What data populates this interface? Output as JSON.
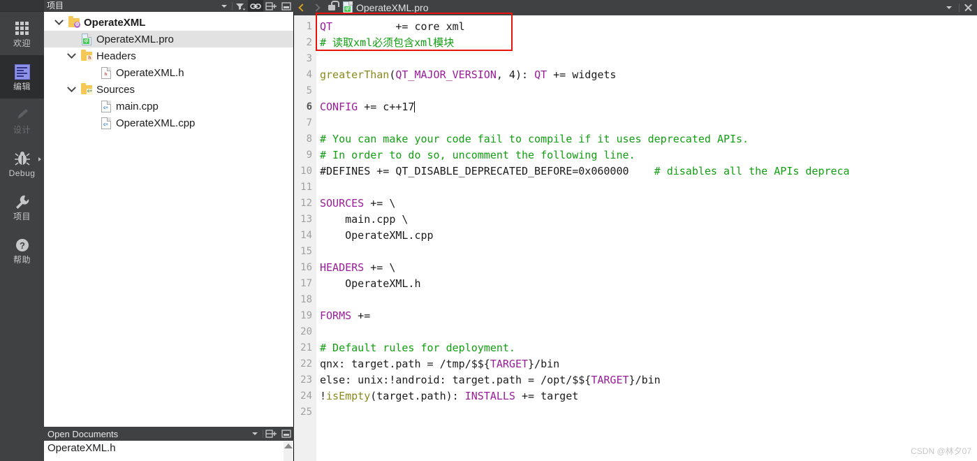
{
  "modebar": {
    "items": [
      {
        "label": "欢迎",
        "icon": "grid-icon",
        "state": "normal"
      },
      {
        "label": "编辑",
        "icon": "edit-icon",
        "state": "selected"
      },
      {
        "label": "设计",
        "icon": "pencil-icon",
        "state": "disabled"
      },
      {
        "label": "Debug",
        "icon": "bug-icon",
        "state": "normal"
      },
      {
        "label": "项目",
        "icon": "wrench-icon",
        "state": "normal"
      },
      {
        "label": "帮助",
        "icon": "question-icon",
        "state": "normal"
      }
    ]
  },
  "project_panel": {
    "title": "项目",
    "header_buttons": [
      {
        "name": "filter-icon",
        "label": ""
      },
      {
        "name": "link-icon",
        "label": ""
      },
      {
        "name": "split-add-icon",
        "label": ""
      },
      {
        "name": "minimize-icon",
        "label": ""
      }
    ],
    "tree": [
      {
        "label": "OperateXML",
        "depth": 0,
        "icon": "folder-project-icon",
        "expanded": true,
        "bold": true,
        "selected": false
      },
      {
        "label": "OperateXML.pro",
        "depth": 1,
        "icon": "file-pro-icon",
        "expanded": null,
        "bold": false,
        "selected": true
      },
      {
        "label": "Headers",
        "depth": 1,
        "icon": "folder-headers-icon",
        "expanded": true,
        "bold": false,
        "selected": false
      },
      {
        "label": "OperateXML.h",
        "depth": 2,
        "icon": "file-h-icon",
        "expanded": null,
        "bold": false,
        "selected": false
      },
      {
        "label": "Sources",
        "depth": 1,
        "icon": "folder-sources-icon",
        "expanded": true,
        "bold": false,
        "selected": false
      },
      {
        "label": "main.cpp",
        "depth": 2,
        "icon": "file-cpp-icon",
        "expanded": null,
        "bold": false,
        "selected": false
      },
      {
        "label": "OperateXML.cpp",
        "depth": 2,
        "icon": "file-cpp-icon",
        "expanded": null,
        "bold": false,
        "selected": false
      }
    ]
  },
  "open_documents": {
    "title": "Open Documents",
    "items": [
      {
        "label": "OperateXML.h"
      }
    ]
  },
  "editor": {
    "tab": {
      "filename": "OperateXML.pro",
      "back_icon": "back-arrow-icon",
      "forward_icon": "forward-arrow-icon",
      "lock_icon": "unlocked-padlock-icon",
      "file_icon": "file-pro-icon",
      "dropdown_icon": "chevron-down-icon",
      "close_icon": "close-icon"
    },
    "cursor_line": 6,
    "lines": [
      {
        "n": 1,
        "tokens": [
          {
            "t": "QT",
            "c": "t-var"
          },
          {
            "t": "          += core xml",
            "c": "t-plain"
          }
        ]
      },
      {
        "n": 2,
        "tokens": [
          {
            "t": "# 读取xml必须包含xml模块",
            "c": "t-cmt"
          }
        ]
      },
      {
        "n": 3,
        "tokens": []
      },
      {
        "n": 4,
        "tokens": [
          {
            "t": "greaterThan",
            "c": "t-fn"
          },
          {
            "t": "(",
            "c": "t-plain"
          },
          {
            "t": "QT_MAJOR_VERSION",
            "c": "t-var"
          },
          {
            "t": ", 4): ",
            "c": "t-plain"
          },
          {
            "t": "QT",
            "c": "t-var"
          },
          {
            "t": " += widgets",
            "c": "t-plain"
          }
        ]
      },
      {
        "n": 5,
        "tokens": []
      },
      {
        "n": 6,
        "tokens": [
          {
            "t": "CONFIG",
            "c": "t-var"
          },
          {
            "t": " += c++17",
            "c": "t-plain"
          }
        ],
        "caret": true
      },
      {
        "n": 7,
        "tokens": []
      },
      {
        "n": 8,
        "tokens": [
          {
            "t": "# You can make your code fail to compile if it uses deprecated APIs.",
            "c": "t-cmt"
          }
        ]
      },
      {
        "n": 9,
        "tokens": [
          {
            "t": "# In order to do so, uncomment the following line.",
            "c": "t-cmt"
          }
        ]
      },
      {
        "n": 10,
        "tokens": [
          {
            "t": "#DEFINES += QT_DISABLE_DEPRECATED_BEFORE=0x060000",
            "c": "t-plain"
          },
          {
            "t": "    # disables all the APIs depreca",
            "c": "t-cmt"
          }
        ]
      },
      {
        "n": 11,
        "tokens": []
      },
      {
        "n": 12,
        "tokens": [
          {
            "t": "SOURCES",
            "c": "t-var"
          },
          {
            "t": " += \\",
            "c": "t-plain"
          }
        ]
      },
      {
        "n": 13,
        "tokens": [
          {
            "t": "    main.cpp \\",
            "c": "t-plain"
          }
        ]
      },
      {
        "n": 14,
        "tokens": [
          {
            "t": "    OperateXML.cpp",
            "c": "t-plain"
          }
        ]
      },
      {
        "n": 15,
        "tokens": []
      },
      {
        "n": 16,
        "tokens": [
          {
            "t": "HEADERS",
            "c": "t-var"
          },
          {
            "t": " += \\",
            "c": "t-plain"
          }
        ]
      },
      {
        "n": 17,
        "tokens": [
          {
            "t": "    OperateXML.h",
            "c": "t-plain"
          }
        ]
      },
      {
        "n": 18,
        "tokens": []
      },
      {
        "n": 19,
        "tokens": [
          {
            "t": "FORMS",
            "c": "t-var"
          },
          {
            "t": " +=",
            "c": "t-plain"
          }
        ]
      },
      {
        "n": 20,
        "tokens": []
      },
      {
        "n": 21,
        "tokens": [
          {
            "t": "# Default rules for deployment.",
            "c": "t-cmt"
          }
        ]
      },
      {
        "n": 22,
        "tokens": [
          {
            "t": "qnx: target.path = /tmp/$${",
            "c": "t-plain"
          },
          {
            "t": "TARGET",
            "c": "t-var"
          },
          {
            "t": "}/bin",
            "c": "t-plain"
          }
        ]
      },
      {
        "n": 23,
        "tokens": [
          {
            "t": "else: unix:!android: target.path = /opt/$${",
            "c": "t-plain"
          },
          {
            "t": "TARGET",
            "c": "t-var"
          },
          {
            "t": "}/bin",
            "c": "t-plain"
          }
        ]
      },
      {
        "n": 24,
        "tokens": [
          {
            "t": "!",
            "c": "t-plain"
          },
          {
            "t": "isEmpty",
            "c": "t-fn"
          },
          {
            "t": "(target.path): ",
            "c": "t-plain"
          },
          {
            "t": "INSTALLS",
            "c": "t-var"
          },
          {
            "t": " += target",
            "c": "t-plain"
          }
        ]
      },
      {
        "n": 25,
        "tokens": []
      }
    ]
  },
  "annotation": {
    "name": "red-highlight-box"
  },
  "watermark": {
    "text": "CSDN @林夕07"
  },
  "colors": {
    "chrome": "#3f4142",
    "chrome_dark": "#2b2d2e",
    "accent_red": "#e8150f",
    "variable": "#9b1c9b",
    "comment": "#11a011",
    "function": "#8a8a1c",
    "selection": "#e2e2e2"
  }
}
